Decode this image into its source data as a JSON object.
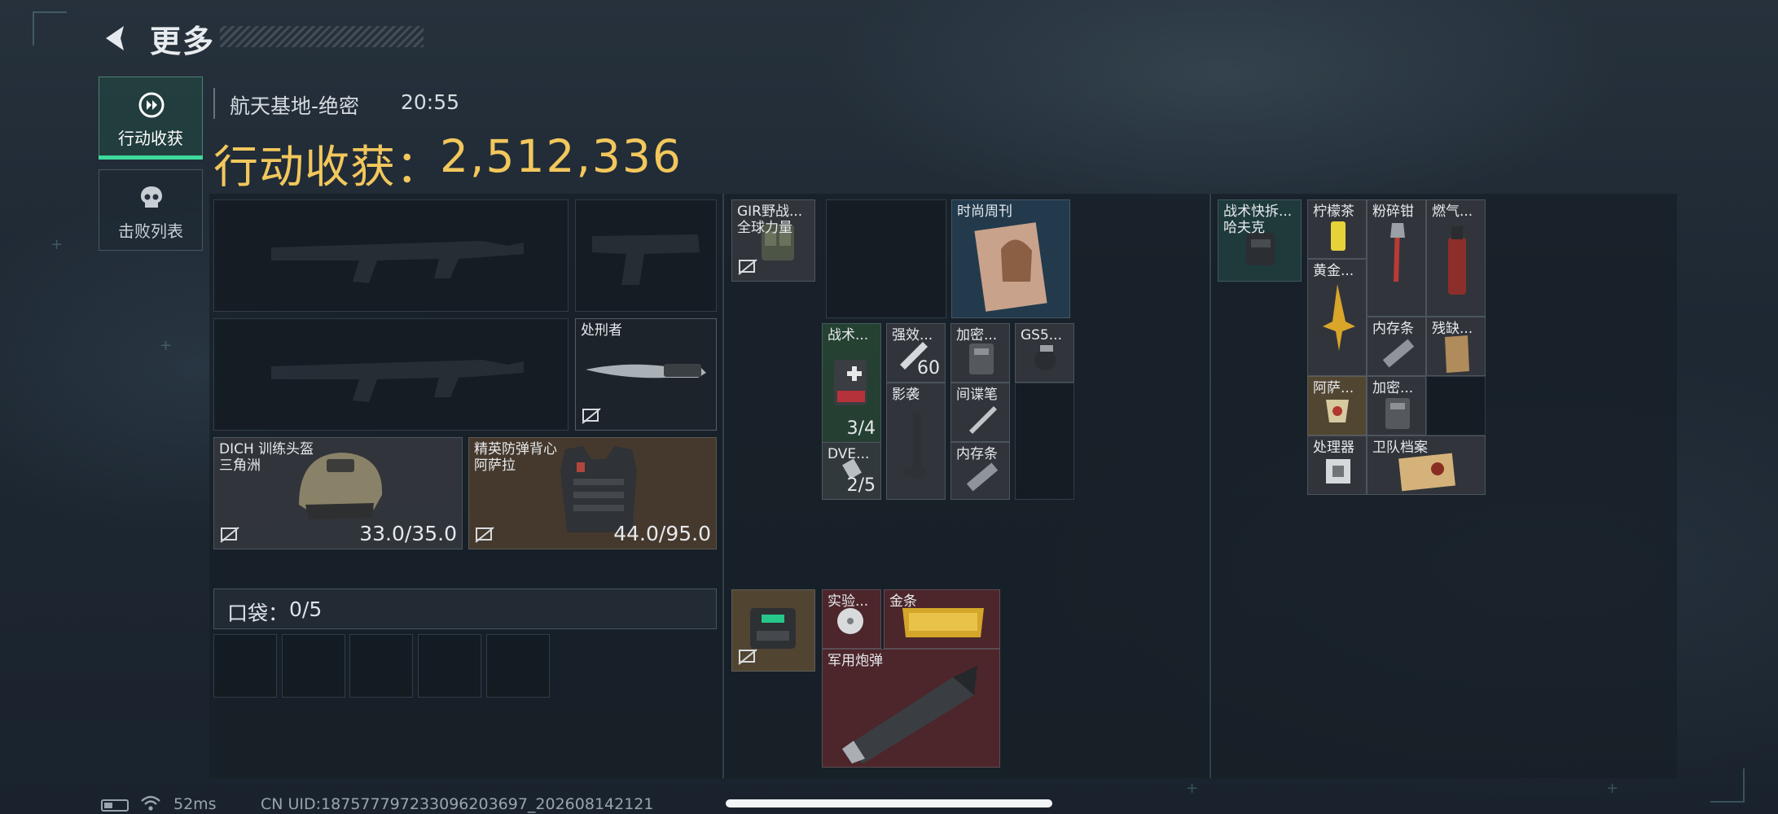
{
  "header": {
    "title": "更多"
  },
  "tabs": [
    {
      "label": "行动收获",
      "active": true
    },
    {
      "label": "击败列表",
      "active": false
    }
  ],
  "match": {
    "map": "航天基地-绝密",
    "time": "20:55"
  },
  "loot": {
    "label": "行动收获：",
    "value": "2,512,336"
  },
  "equipment": {
    "knife_name": "处刑者",
    "helmet": {
      "name": "DICH 训练头盔",
      "sub": "三角洲",
      "durability": "33.0/35.0"
    },
    "armor": {
      "name": "精英防弹背心",
      "sub": "阿萨拉",
      "durability": "44.0/95.0"
    }
  },
  "pocket": {
    "label": "口袋：",
    "count": "0/5"
  },
  "backpack_items": {
    "gir": {
      "name": "GIR野战...",
      "sub": "全球力量"
    },
    "magazine": {
      "name": "时尚周刊"
    },
    "med": {
      "name": "战术...",
      "count": "3/4"
    },
    "stim": {
      "name": "强效...",
      "count": "60"
    },
    "encrypted1": {
      "name": "加密..."
    },
    "gs5": {
      "name": "GS5..."
    },
    "yingxi": {
      "name": "影袭"
    },
    "spy": {
      "name": "间谍笔"
    },
    "memory1": {
      "name": "内存条"
    },
    "dve": {
      "name": "DVE...",
      "count": "2/5"
    },
    "experiment": {
      "name": "实验..."
    },
    "gold": {
      "name": "金条"
    },
    "shell": {
      "name": "军用炮弹"
    }
  },
  "rig_items": {
    "rig": {
      "name": "战术快拆...",
      "sub": "哈夫克"
    },
    "tea": {
      "name": "柠檬茶"
    },
    "crusher": {
      "name": "粉碎钳"
    },
    "gas": {
      "name": "燃气..."
    },
    "golden": {
      "name": "黄金..."
    },
    "memory2": {
      "name": "内存条"
    },
    "broken": {
      "name": "残缺..."
    },
    "asa": {
      "name": "阿萨..."
    },
    "encrypted2": {
      "name": "加密..."
    },
    "processor": {
      "name": "处理器"
    },
    "guard": {
      "name": "卫队档案"
    }
  },
  "status": {
    "ping": "52ms",
    "uid": "CN UID:18757779723309620369​7_202608142121"
  },
  "colors": {
    "accent": "#3ed99d",
    "loot_gold": "#f2c75c"
  }
}
